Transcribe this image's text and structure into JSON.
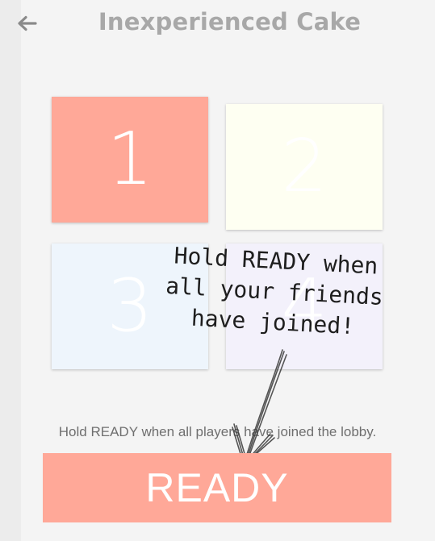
{
  "header": {
    "back_icon": "arrow-left-icon",
    "title": "Inexperienced Cake"
  },
  "slots": [
    {
      "label": "1",
      "color": "#ffa898",
      "active": true
    },
    {
      "label": "2",
      "color": "#fefff2",
      "active": false
    },
    {
      "label": "3",
      "color": "#eef5fc",
      "active": false
    },
    {
      "label": "4",
      "color": "#f3f1fb",
      "active": false
    }
  ],
  "annotation": {
    "line1": "Hold READY when",
    "line2": "all your friends",
    "line3": "have joined!",
    "arrow_icon": "hand-drawn-arrow-icon"
  },
  "instruction": "Hold READY when all players have joined the lobby.",
  "ready_button": {
    "label": "READY",
    "color": "#ffa898"
  }
}
